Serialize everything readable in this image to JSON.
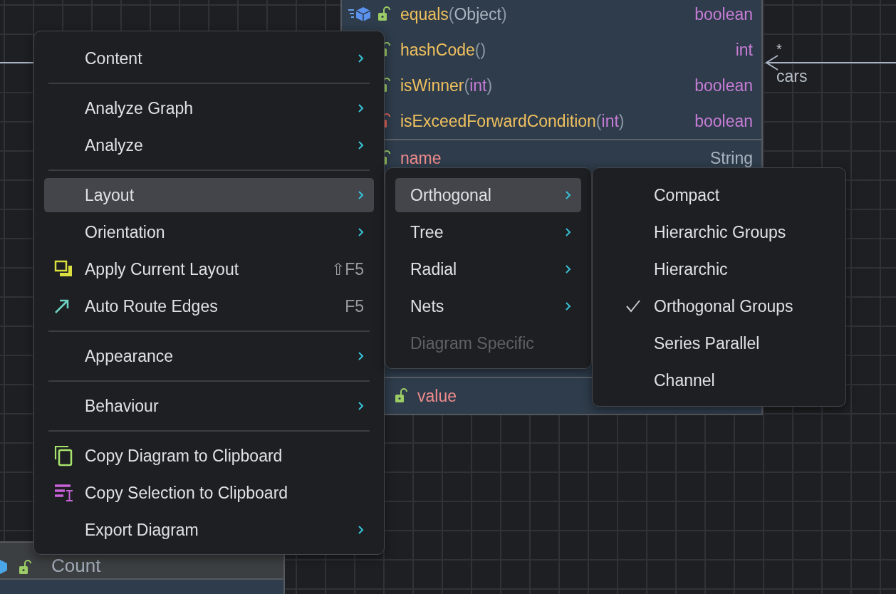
{
  "canvas": {
    "class_node": {
      "methods": [
        {
          "parts": [
            {
              "text": "equals",
              "kind": "name"
            },
            {
              "text": "(",
              "kind": "punct"
            },
            {
              "text": "Object",
              "kind": "class"
            },
            {
              "text": ")",
              "kind": "punct"
            }
          ],
          "type": "boolean",
          "private": false
        },
        {
          "parts": [
            {
              "text": "hashCode",
              "kind": "name"
            },
            {
              "text": "()",
              "kind": "punct"
            }
          ],
          "type": "int",
          "private": false
        },
        {
          "parts": [
            {
              "text": "isWinner",
              "kind": "name"
            },
            {
              "text": "(",
              "kind": "punct"
            },
            {
              "text": "int",
              "kind": "primitive"
            },
            {
              "text": ")",
              "kind": "punct"
            }
          ],
          "type": "boolean",
          "private": false
        },
        {
          "parts": [
            {
              "text": "isExceedForwardCondition",
              "kind": "name"
            },
            {
              "text": "(",
              "kind": "punct"
            },
            {
              "text": "int",
              "kind": "primitive"
            },
            {
              "text": ")",
              "kind": "punct"
            }
          ],
          "type": "boolean",
          "private": true
        }
      ],
      "fields": [
        {
          "name": "name",
          "type": "String",
          "private": false
        },
        {
          "name": "value",
          "private": false
        }
      ]
    },
    "edge": {
      "multiplicity": "*",
      "role": "cars"
    },
    "count_node": {
      "title": "Count"
    }
  },
  "context_menu": {
    "items": [
      {
        "kind": "item",
        "label": "Content",
        "submenu": true,
        "selected": false
      },
      {
        "kind": "separator"
      },
      {
        "kind": "item",
        "label": "Analyze Graph",
        "submenu": true,
        "selected": false
      },
      {
        "kind": "item",
        "label": "Analyze",
        "submenu": true,
        "selected": false
      },
      {
        "kind": "separator"
      },
      {
        "kind": "item",
        "label": "Layout",
        "submenu": true,
        "selected": true
      },
      {
        "kind": "item",
        "label": "Orientation",
        "submenu": true,
        "selected": false
      },
      {
        "kind": "apply",
        "label": "Apply Current Layout",
        "shortcut": "⇧F5",
        "selected": false
      },
      {
        "kind": "route",
        "label": "Auto Route Edges",
        "shortcut": "F5",
        "selected": false
      },
      {
        "kind": "separator"
      },
      {
        "kind": "item",
        "label": "Appearance",
        "submenu": true,
        "selected": false
      },
      {
        "kind": "separator"
      },
      {
        "kind": "item",
        "label": "Behaviour",
        "submenu": true,
        "selected": false
      },
      {
        "kind": "separator"
      },
      {
        "kind": "copy",
        "label": "Copy Diagram to Clipboard",
        "selected": false
      },
      {
        "kind": "select",
        "label": "Copy Selection to Clipboard",
        "selected": false
      },
      {
        "kind": "item",
        "label": "Export Diagram",
        "submenu": true,
        "selected": false
      }
    ]
  },
  "layout_submenu": {
    "items": [
      {
        "label": "Orthogonal",
        "submenu": true,
        "selected": true,
        "disabled": false
      },
      {
        "label": "Tree",
        "submenu": true,
        "selected": false,
        "disabled": false
      },
      {
        "label": "Radial",
        "submenu": true,
        "selected": false,
        "disabled": false
      },
      {
        "label": "Nets",
        "submenu": true,
        "selected": false,
        "disabled": false
      },
      {
        "label": "Diagram Specific",
        "submenu": false,
        "selected": false,
        "disabled": true
      }
    ]
  },
  "orthogonal_submenu": {
    "items": [
      {
        "label": "Compact",
        "checked": false
      },
      {
        "label": "Hierarchic Groups",
        "checked": false
      },
      {
        "label": "Hierarchic",
        "checked": false
      },
      {
        "label": "Orthogonal Groups",
        "checked": true
      },
      {
        "label": "Series Parallel",
        "checked": false
      },
      {
        "label": "Channel",
        "checked": false
      }
    ]
  }
}
